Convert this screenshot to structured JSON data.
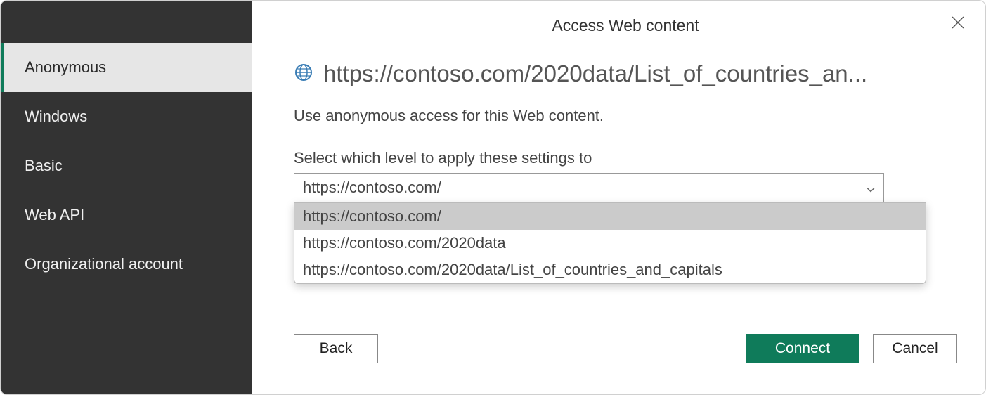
{
  "dialog": {
    "title": "Access Web content"
  },
  "sidebar": {
    "items": [
      {
        "label": "Anonymous",
        "selected": true
      },
      {
        "label": "Windows",
        "selected": false
      },
      {
        "label": "Basic",
        "selected": false
      },
      {
        "label": "Web API",
        "selected": false
      },
      {
        "label": "Organizational account",
        "selected": false
      }
    ]
  },
  "main": {
    "url": "https://contoso.com/2020data/List_of_countries_an...",
    "instruction": "Use anonymous access for this Web content.",
    "select_label": "Select which level to apply these settings to",
    "select_value": "https://contoso.com/",
    "dropdown_options": [
      "https://contoso.com/",
      "https://contoso.com/2020data",
      "https://contoso.com/2020data/List_of_countries_and_capitals"
    ]
  },
  "buttons": {
    "back": "Back",
    "connect": "Connect",
    "cancel": "Cancel"
  }
}
